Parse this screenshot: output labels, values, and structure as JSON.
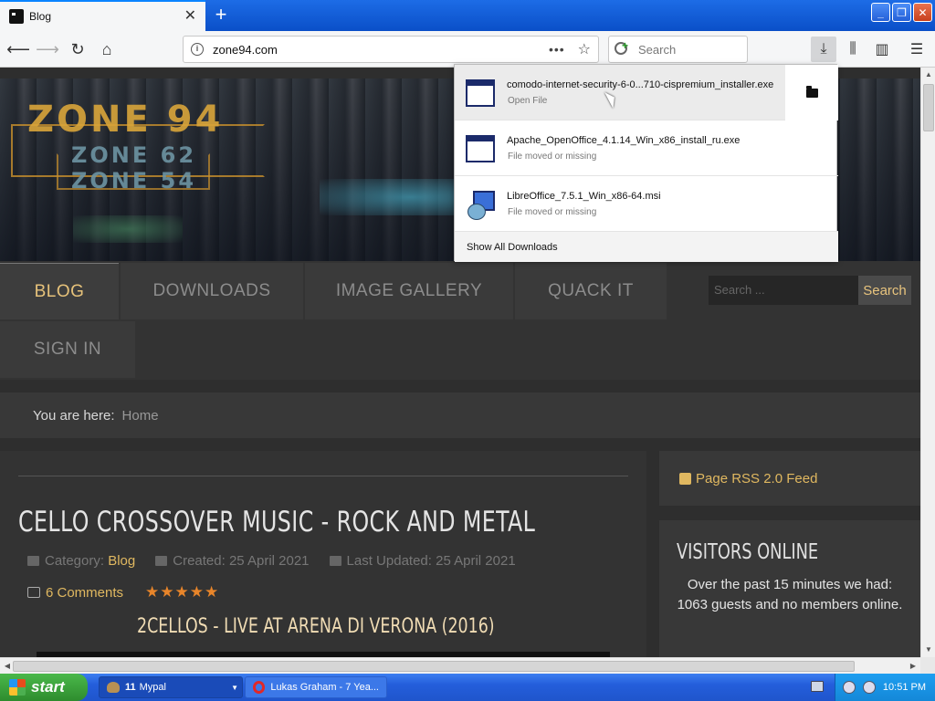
{
  "browser": {
    "tab_title": "Blog",
    "url": "zone94.com",
    "search_placeholder": "Search",
    "more_glyph": "•••"
  },
  "downloads": {
    "items": [
      {
        "name": "comodo-internet-security-6-0...710-cispremium_installer.exe",
        "status": "Open File"
      },
      {
        "name": "Apache_OpenOffice_4.1.14_Win_x86_install_ru.exe",
        "status": "File moved or missing"
      },
      {
        "name": "LibreOffice_7.5.1_Win_x86-64.msi",
        "status": "File moved or missing"
      }
    ],
    "show_all": "Show All Downloads"
  },
  "site": {
    "logo_main": "ZONE 94",
    "logo_sub1": "ZONE 62",
    "logo_sub2": "ZONE 54",
    "menu": [
      "BLOG",
      "DOWNLOADS",
      "IMAGE GALLERY",
      "QUACK IT",
      "SIGN IN"
    ],
    "search_placeholder": "Search ...",
    "search_button": "Search",
    "breadcrumb_lead": "You are here:",
    "breadcrumb_home": "Home",
    "article": {
      "title": "CELLO CROSSOVER MUSIC - ROCK AND METAL",
      "category_label": "Category:",
      "category": "Blog",
      "created": "Created: 25 April 2021",
      "updated": "Last Updated: 25 April 2021",
      "comments": "6 Comments",
      "rating": 5,
      "stars": "★★★★★",
      "video_title": "2CELLOS - LIVE AT ARENA DI VERONA (2016)"
    },
    "rss": "Page RSS 2.0 Feed",
    "visitors_title": "VISITORS ONLINE",
    "visitors_text": "Over the past 15 minutes we had: 1063 guests and no members online."
  },
  "taskbar": {
    "start": "start",
    "group_count": "11",
    "group_label": "Mypal",
    "opera_task": "Lukas Graham - 7 Yea...",
    "clock": "10:51 PM"
  },
  "colors": {
    "accent_gold": "#e0b860",
    "menu_active": "#e6c27a",
    "stars": "#e8852a"
  }
}
